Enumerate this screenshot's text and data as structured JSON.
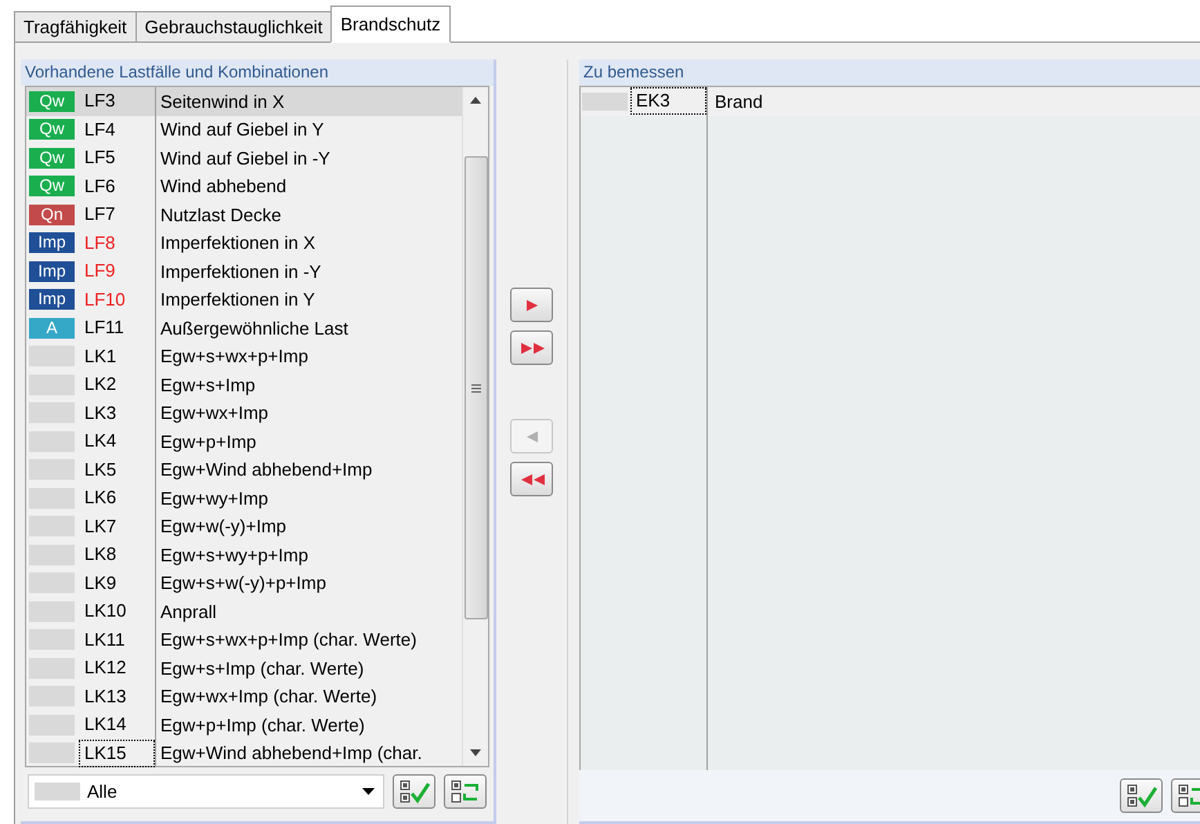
{
  "tabs": [
    {
      "label": "Tragfähigkeit",
      "selected": false
    },
    {
      "label": "Gebrauchstauglichkeit",
      "selected": false
    },
    {
      "label": "Brandschutz",
      "selected": true
    }
  ],
  "available": {
    "title": "Vorhandene Lastfälle und Kombinationen",
    "rows": [
      {
        "tag": "Qw",
        "color": "#1aae4f",
        "name": "LF3",
        "red": false,
        "description": "Seitenwind in X",
        "selected": true,
        "focused": false
      },
      {
        "tag": "Qw",
        "color": "#1aae4f",
        "name": "LF4",
        "red": false,
        "description": "Wind auf Giebel in Y",
        "selected": false,
        "focused": false
      },
      {
        "tag": "Qw",
        "color": "#1aae4f",
        "name": "LF5",
        "red": false,
        "description": "Wind auf Giebel in -Y",
        "selected": false,
        "focused": false
      },
      {
        "tag": "Qw",
        "color": "#1aae4f",
        "name": "LF6",
        "red": false,
        "description": "Wind abhebend",
        "selected": false,
        "focused": false
      },
      {
        "tag": "Qn",
        "color": "#c34a4a",
        "name": "LF7",
        "red": false,
        "description": "Nutzlast Decke",
        "selected": false,
        "focused": false
      },
      {
        "tag": "Imp",
        "color": "#1f4f96",
        "name": "LF8",
        "red": true,
        "description": "Imperfektionen in X",
        "selected": false,
        "focused": false
      },
      {
        "tag": "Imp",
        "color": "#1f4f96",
        "name": "LF9",
        "red": true,
        "description": "Imperfektionen in -Y",
        "selected": false,
        "focused": false
      },
      {
        "tag": "Imp",
        "color": "#1f4f96",
        "name": "LF10",
        "red": true,
        "description": "Imperfektionen in Y",
        "selected": false,
        "focused": false
      },
      {
        "tag": "A",
        "color": "#35a8c8",
        "name": "LF11",
        "red": false,
        "description": "Außergewöhnliche Last",
        "selected": false,
        "focused": false
      },
      {
        "name": "LK1",
        "red": false,
        "description": "Egw+s+wx+p+Imp",
        "selected": false,
        "focused": false
      },
      {
        "name": "LK2",
        "red": false,
        "description": "Egw+s+Imp",
        "selected": false,
        "focused": false
      },
      {
        "name": "LK3",
        "red": false,
        "description": "Egw+wx+Imp",
        "selected": false,
        "focused": false
      },
      {
        "name": "LK4",
        "red": false,
        "description": "Egw+p+Imp",
        "selected": false,
        "focused": false
      },
      {
        "name": "LK5",
        "red": false,
        "description": "Egw+Wind abhebend+Imp",
        "selected": false,
        "focused": false
      },
      {
        "name": "LK6",
        "red": false,
        "description": "Egw+wy+Imp",
        "selected": false,
        "focused": false
      },
      {
        "name": "LK7",
        "red": false,
        "description": "Egw+w(-y)+Imp",
        "selected": false,
        "focused": false
      },
      {
        "name": "LK8",
        "red": false,
        "description": "Egw+s+wy+p+Imp",
        "selected": false,
        "focused": false
      },
      {
        "name": "LK9",
        "red": false,
        "description": "Egw+s+w(-y)+p+Imp",
        "selected": false,
        "focused": false
      },
      {
        "name": "LK10",
        "red": false,
        "description": "Anprall",
        "selected": false,
        "focused": false
      },
      {
        "name": "LK11",
        "red": false,
        "description": "Egw+s+wx+p+Imp (char. Werte)",
        "selected": false,
        "focused": false
      },
      {
        "name": "LK12",
        "red": false,
        "description": "Egw+s+Imp (char. Werte)",
        "selected": false,
        "focused": false
      },
      {
        "name": "LK13",
        "red": false,
        "description": "Egw+wx+Imp (char. Werte)",
        "selected": false,
        "focused": false
      },
      {
        "name": "LK14",
        "red": false,
        "description": "Egw+p+Imp (char. Werte)",
        "selected": false,
        "focused": false
      },
      {
        "name": "LK15",
        "red": false,
        "description": "Egw+Wind abhebend+Imp (char.",
        "selected": false,
        "focused": true
      }
    ],
    "filter": {
      "value": "Alle"
    }
  },
  "transfer_buttons": [
    {
      "kind": "one-right",
      "disabled": false
    },
    {
      "kind": "all-right",
      "disabled": false
    },
    {
      "kind": "one-left",
      "disabled": true
    },
    {
      "kind": "all-left",
      "disabled": false
    }
  ],
  "to_design": {
    "title": "Zu bemessen",
    "rows": [
      {
        "name": "EK3",
        "description": "Brand",
        "focused": true
      }
    ]
  }
}
